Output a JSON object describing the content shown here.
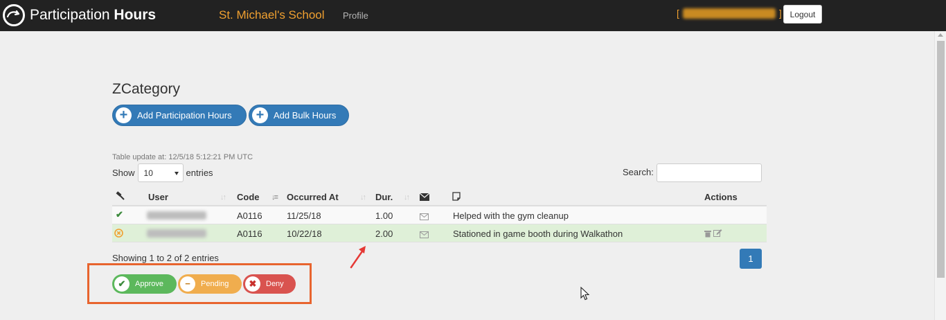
{
  "navbar": {
    "brand_light": "Participation ",
    "brand_bold": "Hours",
    "school": "St. Michael's School",
    "profile_link": "Profile",
    "bracket_open": "[",
    "bracket_close": "]",
    "logout_label": "Logout"
  },
  "page": {
    "title": "ZCategory",
    "add_hours_label": "Add Participation Hours",
    "add_bulk_label": "Add Bulk Hours",
    "update_note": "Table update at: 12/5/18 5:12:21 PM UTC",
    "show_label": "Show",
    "entries_label": "entries",
    "page_length": "10",
    "search_label": "Search:",
    "search_value": ""
  },
  "table": {
    "headers": {
      "user": "User",
      "code": "Code",
      "occurred_at": "Occurred At",
      "duration": "Dur.",
      "actions": "Actions"
    },
    "rows": [
      {
        "status": "approved",
        "code": "A0116",
        "occurred_at": "11/25/18",
        "duration": "1.00",
        "note": "Helped with the gym cleanup"
      },
      {
        "status": "pending",
        "code": "A0116",
        "occurred_at": "10/22/18",
        "duration": "2.00",
        "note": "Stationed in game booth during Walkathon"
      }
    ]
  },
  "pagination": {
    "info": "Showing 1 to 2 of 2 entries",
    "current_page": "1"
  },
  "legend": {
    "approve_label": "Approve",
    "pending_label": "Pending",
    "deny_label": "Deny"
  },
  "colors": {
    "navbar_bg": "#222222",
    "accent_orange": "#f0a030",
    "primary_blue": "#337ab7",
    "approve_green": "#5cb85c",
    "pending_orange": "#f0ad4e",
    "deny_red": "#d9534f",
    "annotation_orange": "#e8642e"
  }
}
